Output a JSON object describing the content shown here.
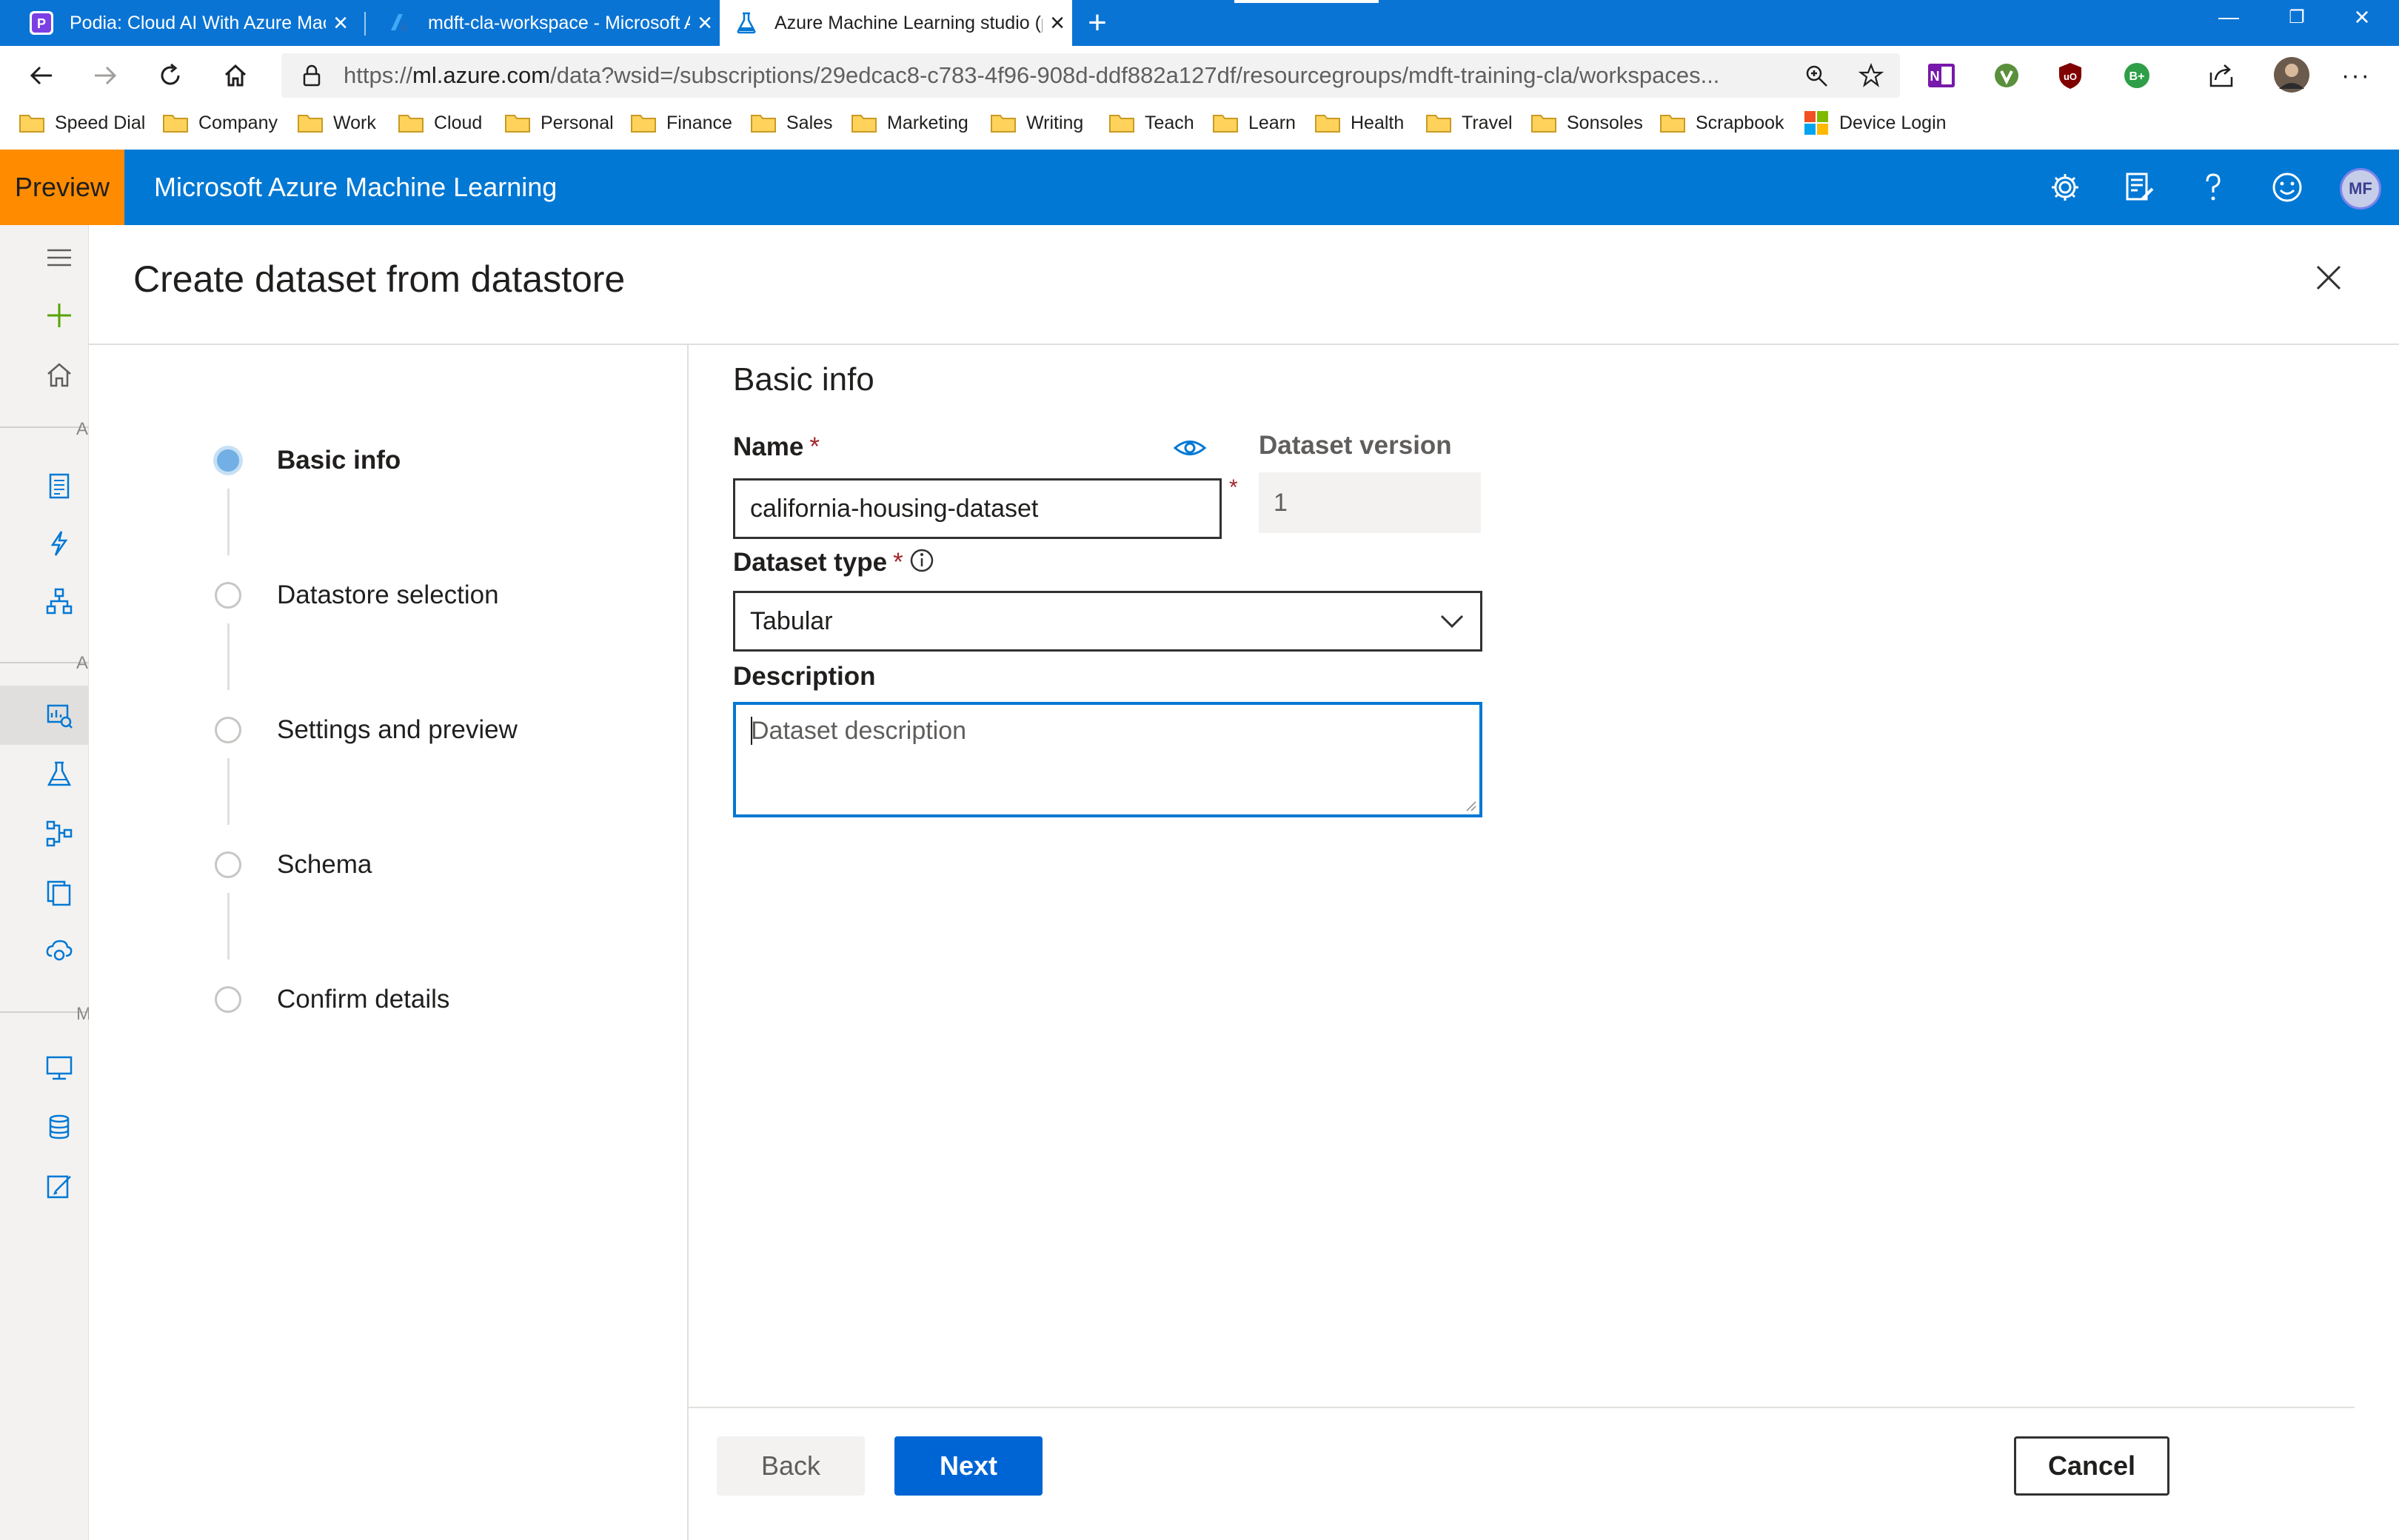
{
  "browser": {
    "tabs": [
      {
        "title": "Podia: Cloud AI With Azure Machine Learning",
        "favicon": "podia-icon",
        "active": false
      },
      {
        "title": "mdft-cla-workspace - Microsoft Azure",
        "favicon": "azure-icon",
        "active": false
      },
      {
        "title": "Azure Machine Learning studio (preview)",
        "favicon": "flask-icon",
        "active": true
      }
    ],
    "url_prefix": "https://",
    "url_host": "ml.azure.com",
    "url_rest": "/data?wsid=/subscriptions/29edcac8-c783-4f96-908d-ddf882a127df/resourcegroups/mdft-training-cla/workspaces...",
    "bookmarks": [
      "Speed Dial",
      "Company",
      "Work",
      "Cloud",
      "Personal",
      "Finance",
      "Sales",
      "Marketing",
      "Writing",
      "Teach",
      "Learn",
      "Health",
      "Travel",
      "Sonsoles",
      "Scrapbook",
      "Device Login"
    ],
    "profile_initials": "B+"
  },
  "app": {
    "preview_label": "Preview",
    "title": "Microsoft Azure Machine Learning",
    "avatar_initials": "MF"
  },
  "rail": {
    "section_letters": [
      "A",
      "A",
      "M"
    ]
  },
  "panel": {
    "title": "Create dataset from datastore",
    "steps": [
      {
        "label": "Basic info",
        "current": true
      },
      {
        "label": "Datastore selection",
        "current": false
      },
      {
        "label": "Settings and preview",
        "current": false
      },
      {
        "label": "Schema",
        "current": false
      },
      {
        "label": "Confirm details",
        "current": false
      }
    ],
    "section_title": "Basic info",
    "form": {
      "name_label": "Name",
      "name_value": "california-housing-dataset",
      "version_label": "Dataset version",
      "version_value": "1",
      "type_label": "Dataset type",
      "type_value": "Tabular",
      "description_label": "Description",
      "description_placeholder": "Dataset description",
      "required_mark": "*"
    },
    "buttons": {
      "back": "Back",
      "next": "Next",
      "cancel": "Cancel"
    }
  },
  "colors": {
    "tabstrip": "#0a74d4",
    "appbar": "#0078d4",
    "preview": "#ff8c00",
    "primary": "#0065d4",
    "required": "#a4262c"
  }
}
